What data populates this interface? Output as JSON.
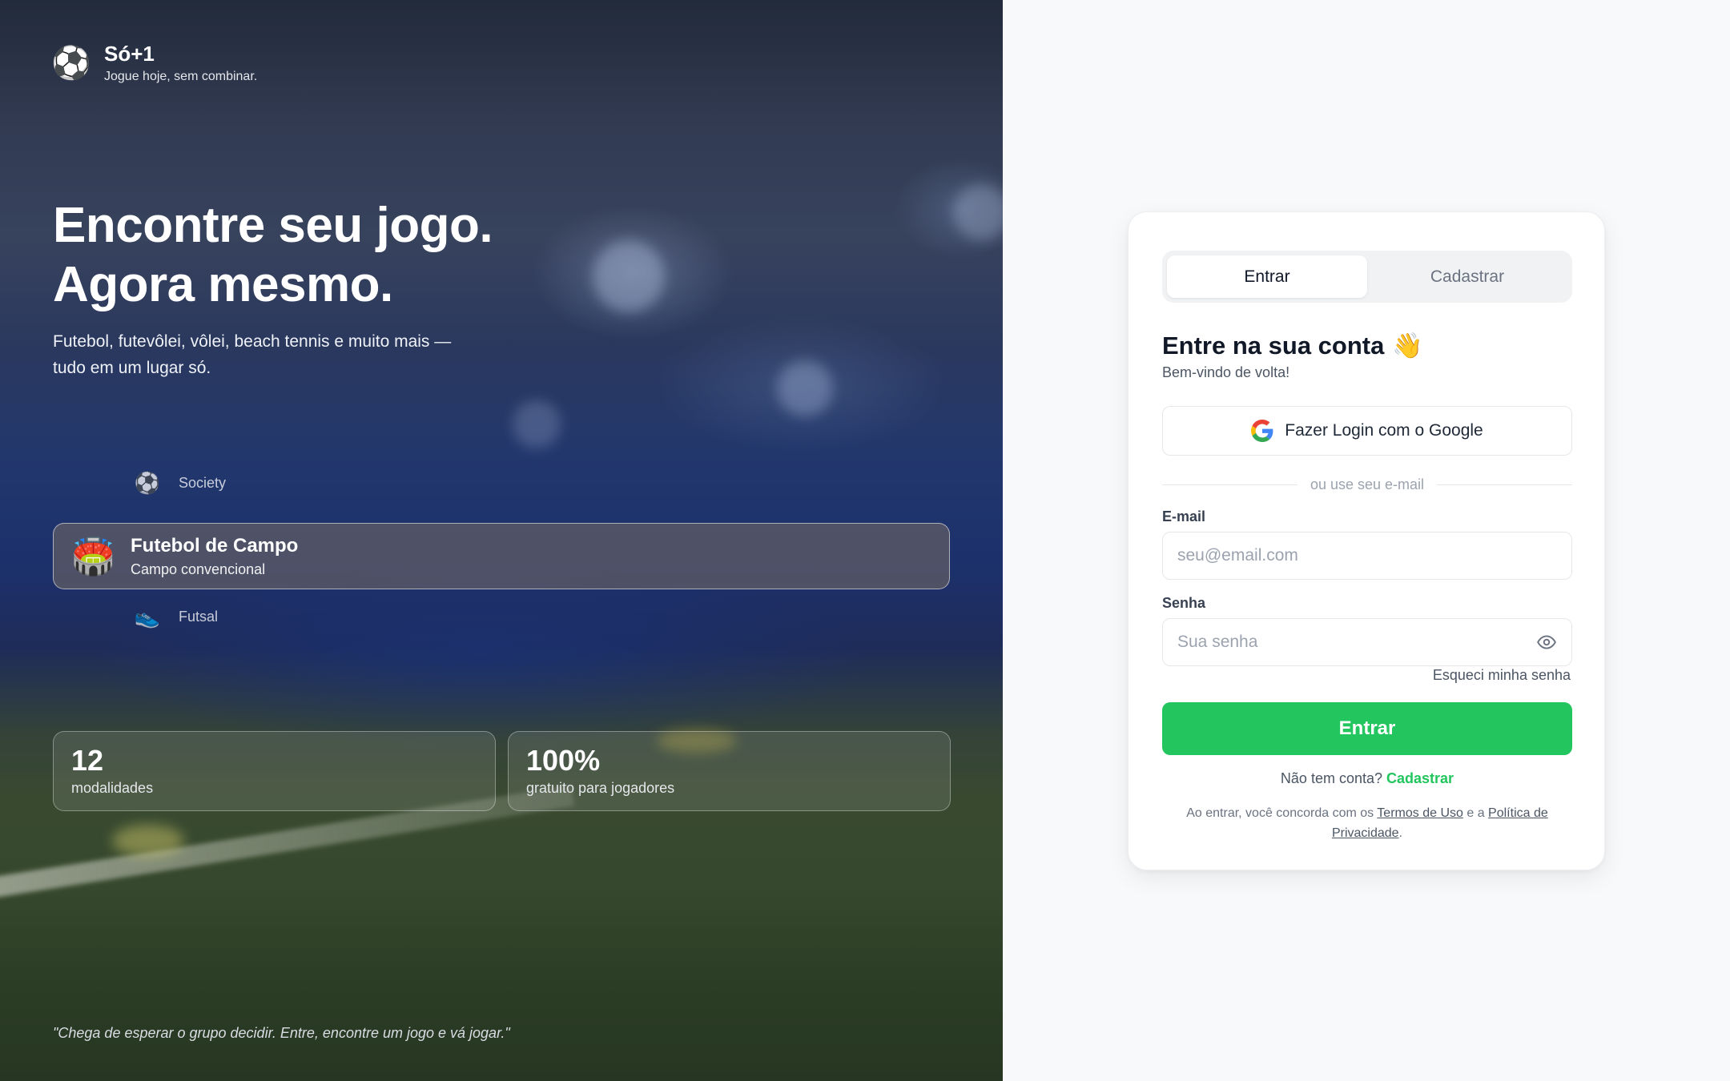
{
  "brand": {
    "icon": "soccer-ball-icon",
    "name": "Só+1",
    "tagline": "Jogue hoje, sem combinar."
  },
  "hero": {
    "headline_line1": "Encontre seu jogo.",
    "headline_line2": "Agora mesmo.",
    "subtitle": "Futebol, futevôlei, vôlei, beach tennis e muito mais — tudo em um lugar só.",
    "sports": [
      {
        "label": "Society",
        "icon": "soccer-ball-icon",
        "state": "faded"
      },
      {
        "title": "Futebol de Campo",
        "subtitle": "Campo convencional",
        "icon": "stadium-icon",
        "state": "active"
      },
      {
        "label": "Futsal",
        "icon": "sneaker-icon",
        "state": "faded"
      }
    ],
    "stats": [
      {
        "value": "12",
        "label": "modalidades"
      },
      {
        "value": "100%",
        "label": "gratuito para jogadores"
      }
    ],
    "quote": "\"Chega de esperar o grupo decidir. Entre, encontre um jogo e vá jogar.\""
  },
  "auth": {
    "tabs": [
      {
        "label": "Entrar",
        "active": true
      },
      {
        "label": "Cadastrar",
        "active": false
      }
    ],
    "title": "Entre na sua conta",
    "title_emoji": "👋",
    "subtitle": "Bem-vindo de volta!",
    "google_button": "Fazer Login com o Google",
    "divider_text": "ou use seu e-mail",
    "email": {
      "label": "E-mail",
      "placeholder": "seu@email.com",
      "value": ""
    },
    "password": {
      "label": "Senha",
      "placeholder": "Sua senha",
      "value": ""
    },
    "forgot_link": "Esqueci minha senha",
    "submit_button": "Entrar",
    "no_account_text": "Não tem conta?",
    "signup_link": "Cadastrar",
    "terms_prefix": "Ao entrar, você concorda com os",
    "terms_link": "Termos de Uso",
    "terms_middle": "e a",
    "privacy_link": "Política de Privacidade",
    "terms_suffix": "."
  },
  "colors": {
    "accent": "#22c55e",
    "card_bg": "#ffffff",
    "page_bg": "#f8f9fa",
    "text_primary": "#111827"
  }
}
